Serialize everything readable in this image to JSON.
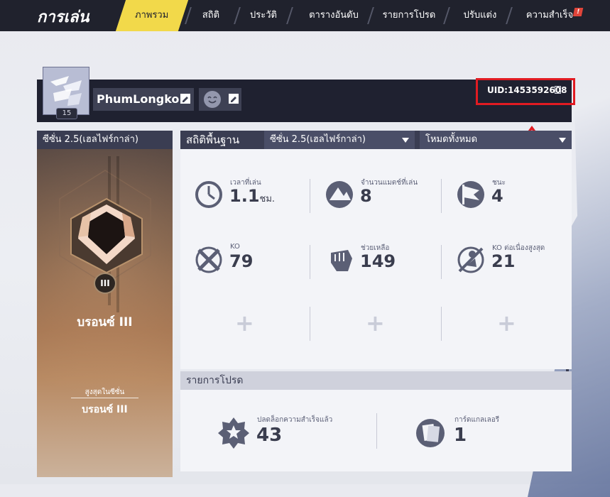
{
  "nav": {
    "title": "การเล่น",
    "tabs": [
      {
        "label": "ภาพรวม",
        "active": true
      },
      {
        "label": "สถิติ"
      },
      {
        "label": "ประวัติ"
      },
      {
        "label": "ตารางอันดับ"
      },
      {
        "label": "รายการโปรด"
      },
      {
        "label": "ปรับแต่ง"
      },
      {
        "label": "ความสำเร็จ"
      }
    ],
    "alert_badge": "!"
  },
  "profile": {
    "username": "PhumLongko",
    "level": "15",
    "uid": "UID:1453592608"
  },
  "rank": {
    "header": "ซีซั่น 2.5(เฮลไฟร์กาล่า)",
    "tier_numeral": "III",
    "name": "บรอนซ์ III",
    "highest_label": "สูงสุดในซีซั่น",
    "highest": "บรอนซ์ III"
  },
  "stats": {
    "title": "สถิติพื้นฐาน",
    "season_select": "ซีซั่น 2.5(เฮลไฟร์กาล่า)",
    "mode_select": "โหมดทั้งหมด",
    "items": [
      {
        "label": "เวลาที่เล่น",
        "value": "1.1",
        "unit": "ชม.",
        "icon": "clock-icon"
      },
      {
        "label": "จำนวนแมตช์ที่เล่น",
        "value": "8",
        "icon": "mountain-icon"
      },
      {
        "label": "ชนะ",
        "value": "4",
        "icon": "flag-icon"
      },
      {
        "label": "KO",
        "value": "79",
        "icon": "crossed-swords-icon"
      },
      {
        "label": "ช่วยเหลือ",
        "value": "149",
        "icon": "fist-icon"
      },
      {
        "label": "KO ต่อเนื่องสูงสุด",
        "value": "21",
        "icon": "streak-icon"
      }
    ],
    "add_slots": [
      "+",
      "+",
      "+"
    ]
  },
  "progression": {
    "title": "รายการโปรด",
    "items": [
      {
        "label": "ปลดล็อกความสำเร็จแล้ว",
        "value": "43",
        "icon": "star-burst-icon"
      },
      {
        "label": "การ์ดแกลเลอรี",
        "value": "1",
        "icon": "card-gallery-icon"
      }
    ]
  },
  "colors": {
    "accent": "#f2d94a",
    "nav_bg": "#20222d",
    "highlight_red": "#e11b22"
  }
}
